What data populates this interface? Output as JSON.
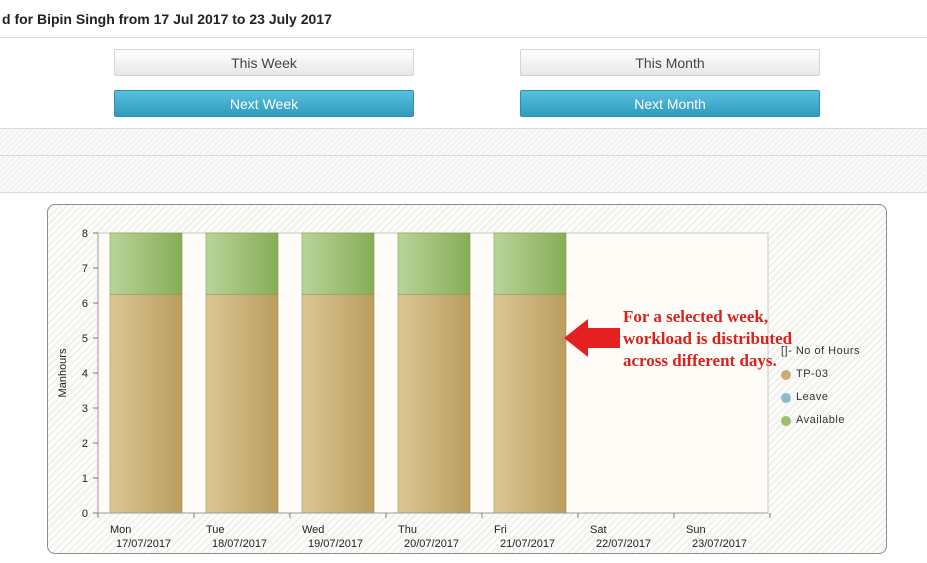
{
  "header": {
    "title": "d for Bipin Singh from 17 Jul 2017 to 23 July 2017"
  },
  "buttons": {
    "this_week": "This Week",
    "this_month": "This Month",
    "next_week": "Next Week",
    "next_month": "Next Month"
  },
  "colors": {
    "accent_blue": "#31a6cc",
    "tp03": "#c9ad74",
    "leave": "#8fb8cc",
    "available": "#9bbf70",
    "annotation": "#e52020"
  },
  "annotation": {
    "text": "For a selected week, workload is distributed across different days."
  },
  "legend": {
    "header": "[]- No of Hours",
    "items": [
      {
        "label": "TP-03",
        "color": "#c9ad74"
      },
      {
        "label": "Leave",
        "color": "#8fb8cc"
      },
      {
        "label": "Available",
        "color": "#9bbf70"
      }
    ]
  },
  "chart_data": {
    "type": "bar",
    "stacked": true,
    "ylabel": "Manhours",
    "xlabel": "",
    "ylim": [
      0,
      8
    ],
    "yticks": [
      0,
      1,
      2,
      3,
      4,
      5,
      6,
      7,
      8
    ],
    "categories": [
      {
        "day": "Mon",
        "date": "17/07/2017"
      },
      {
        "day": "Tue",
        "date": "18/07/2017"
      },
      {
        "day": "Wed",
        "date": "19/07/2017"
      },
      {
        "day": "Thu",
        "date": "20/07/2017"
      },
      {
        "day": "Fri",
        "date": "21/07/2017"
      },
      {
        "day": "Sat",
        "date": "22/07/2017"
      },
      {
        "day": "Sun",
        "date": "23/07/2017"
      }
    ],
    "series": [
      {
        "name": "TP-03",
        "values": [
          6.25,
          6.25,
          6.25,
          6.25,
          6.25,
          0,
          0
        ]
      },
      {
        "name": "Leave",
        "values": [
          0,
          0,
          0,
          0,
          0,
          0,
          0
        ]
      },
      {
        "name": "Available",
        "values": [
          1.75,
          1.75,
          1.75,
          1.75,
          1.75,
          0,
          0
        ]
      }
    ],
    "legend_position": "right"
  }
}
